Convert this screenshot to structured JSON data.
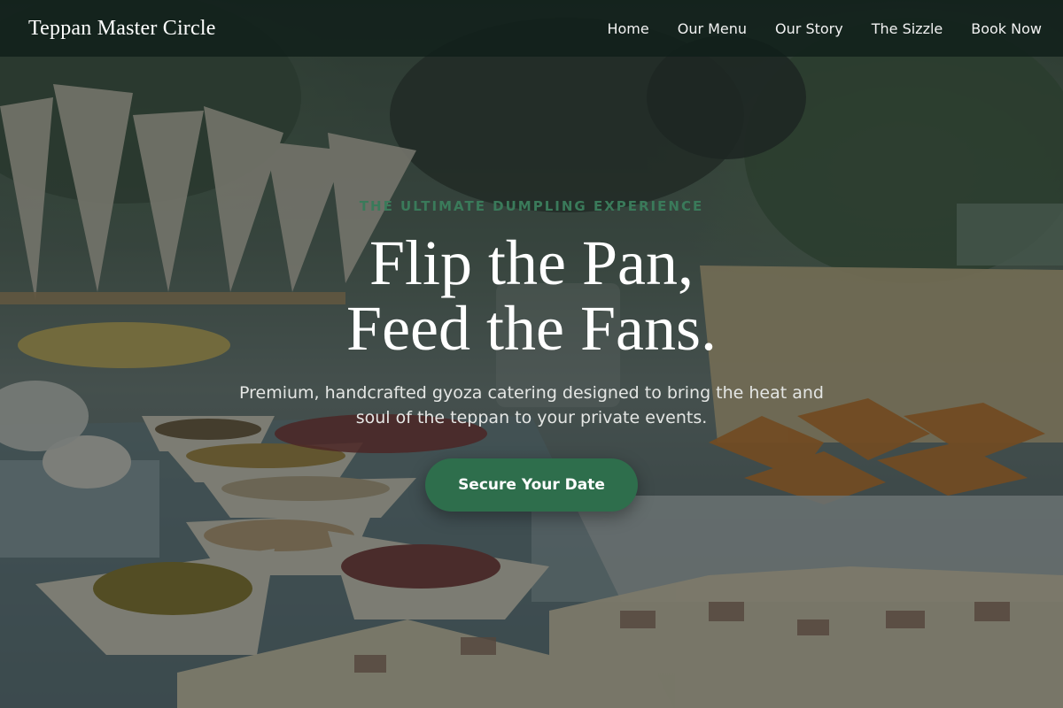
{
  "brand": {
    "name": "Teppan Master Circle"
  },
  "nav": {
    "items": [
      {
        "label": "Home"
      },
      {
        "label": "Our Menu"
      },
      {
        "label": "Our Story"
      },
      {
        "label": "The Sizzle"
      },
      {
        "label": "Book Now"
      }
    ]
  },
  "hero": {
    "eyebrow": "The Ultimate Dumpling Experience",
    "headline_line1": "Flip the Pan,",
    "headline_line2": "Feed the Fans.",
    "subtext": "Premium, handcrafted gyoza catering designed to bring the heat and soul of the teppan to your private events.",
    "cta_label": "Secure Your Date"
  },
  "colors": {
    "accent": "#2e6e4c",
    "eyebrow": "#3a7a5a",
    "navbar": "#101e1a"
  }
}
